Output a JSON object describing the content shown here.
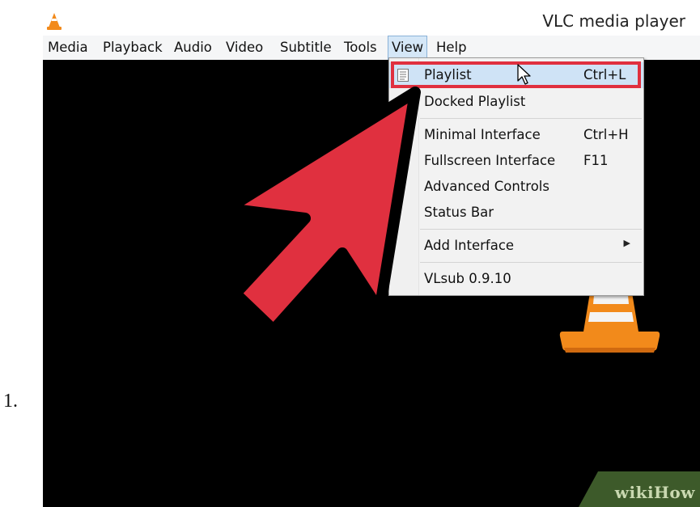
{
  "step": {
    "number": "1."
  },
  "window": {
    "title": "VLC media player"
  },
  "menubar": {
    "items": [
      "Media",
      "Playback",
      "Audio",
      "Video",
      "Subtitle",
      "Tools",
      "View",
      "Help"
    ],
    "active": "View"
  },
  "view_menu": {
    "items": [
      {
        "label": "Playlist",
        "shortcut": "Ctrl+L",
        "icon": "playlist-icon",
        "state": "hovered"
      },
      {
        "label": "Docked Playlist",
        "shortcut": ""
      },
      {
        "label": "Minimal Interface",
        "shortcut": "Ctrl+H"
      },
      {
        "label": "Fullscreen Interface",
        "shortcut": "F11"
      },
      {
        "label": "Advanced Controls",
        "shortcut": ""
      },
      {
        "label": "Status Bar",
        "shortcut": ""
      },
      {
        "label": "Add Interface",
        "shortcut": "",
        "submenu": true
      },
      {
        "label": "VLsub 0.9.10",
        "shortcut": ""
      }
    ]
  },
  "annotation": {
    "arrow_color": "#e0303f",
    "highlight_color": "#e0303f"
  },
  "watermark": {
    "text": "wikiHow"
  },
  "colors": {
    "vlc_orange": "#f28a1b",
    "video_background": "#000000",
    "menu_hover": "#cfe3f6"
  }
}
